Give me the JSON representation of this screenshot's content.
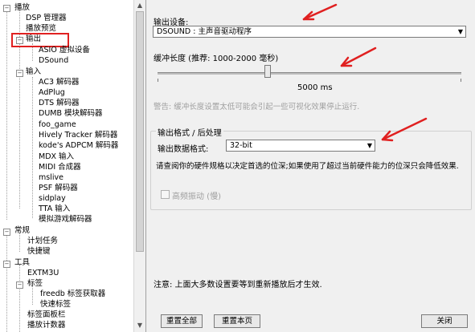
{
  "tree": {
    "items": [
      {
        "label": "播放"
      },
      {
        "label": "DSP 管理器"
      },
      {
        "label": "播放预览"
      },
      {
        "label": "输出"
      },
      {
        "label": "ASIO 虚拟设备"
      },
      {
        "label": "DSound"
      },
      {
        "label": "输入"
      },
      {
        "label": "AC3 解码器"
      },
      {
        "label": "AdPlug"
      },
      {
        "label": "DTS 解码器"
      },
      {
        "label": "DUMB 模块解码器"
      },
      {
        "label": "foo_game"
      },
      {
        "label": "Hively Tracker 解码器"
      },
      {
        "label": "kode's ADPCM 解码器"
      },
      {
        "label": "MDX 输入"
      },
      {
        "label": "MIDI 合成器"
      },
      {
        "label": "mslive"
      },
      {
        "label": "PSF 解码器"
      },
      {
        "label": "sidplay"
      },
      {
        "label": "TTA 输入"
      },
      {
        "label": "模拟游戏解码器"
      },
      {
        "label": "常规"
      },
      {
        "label": "计划任务"
      },
      {
        "label": "快捷键"
      },
      {
        "label": "工具"
      },
      {
        "label": "EXTM3U"
      },
      {
        "label": "标签"
      },
      {
        "label": "freedb 标签获取器"
      },
      {
        "label": "快速标签"
      },
      {
        "label": "标签面板栏"
      },
      {
        "label": "播放计数器"
      }
    ],
    "selected_label": "输出"
  },
  "output": {
    "device_label": "输出设备:",
    "device_value": "DSOUND : 主声音驱动程序",
    "buffer_label": "缓冲长度 (推荐: 1000-2000 毫秒)",
    "buffer_value_text": "5000 ms",
    "buffer_level": 0.5,
    "warning": "警告: 缓冲长度设置太低可能会引起一些可视化效果停止运行.",
    "format_group_label": "输出格式 / 后处理",
    "format_label": "输出数据格式:",
    "format_value": "32-bit",
    "format_hint": "请查阅你的硬件规格以决定首选的位深;如果使用了超过当前硬件能力的位深只会降低效果.",
    "dither_label": "高频振动 (慢)",
    "dither_checked": false
  },
  "footer": {
    "note": "注意: 上面大多数设置要等到重新播放后才生效.",
    "reset_all": "重置全部",
    "reset_page": "重置本页",
    "close": "关闭"
  },
  "annotation_color": "#e02020"
}
